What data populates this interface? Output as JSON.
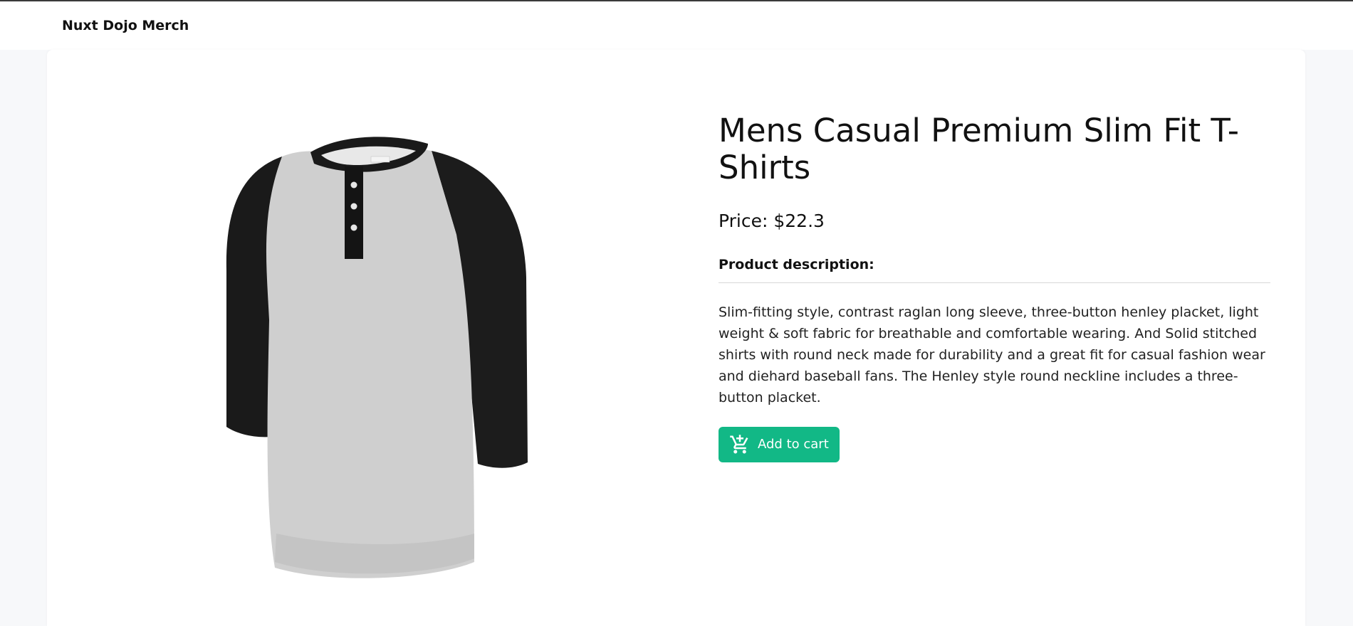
{
  "header": {
    "brand": "Nuxt Dojo Merch"
  },
  "product": {
    "title": "Mens Casual Premium Slim Fit T-Shirts",
    "price_label": "Price: $22.3",
    "description_heading": "Product description:",
    "description": "Slim-fitting style, contrast raglan long sleeve, three-button henley placket, light weight & soft fabric for breathable and comfortable wearing. And Solid stitched shirts with round neck made for durability and a great fit for casual fashion wear and diehard baseball fans. The Henley style round neckline includes a three-button placket.",
    "add_to_cart_label": "Add to cart"
  },
  "icons": {
    "cart": "add-shopping-cart-icon"
  },
  "colors": {
    "accent": "#12b886",
    "page_background": "#f7f8fa",
    "card_background": "#ffffff"
  }
}
